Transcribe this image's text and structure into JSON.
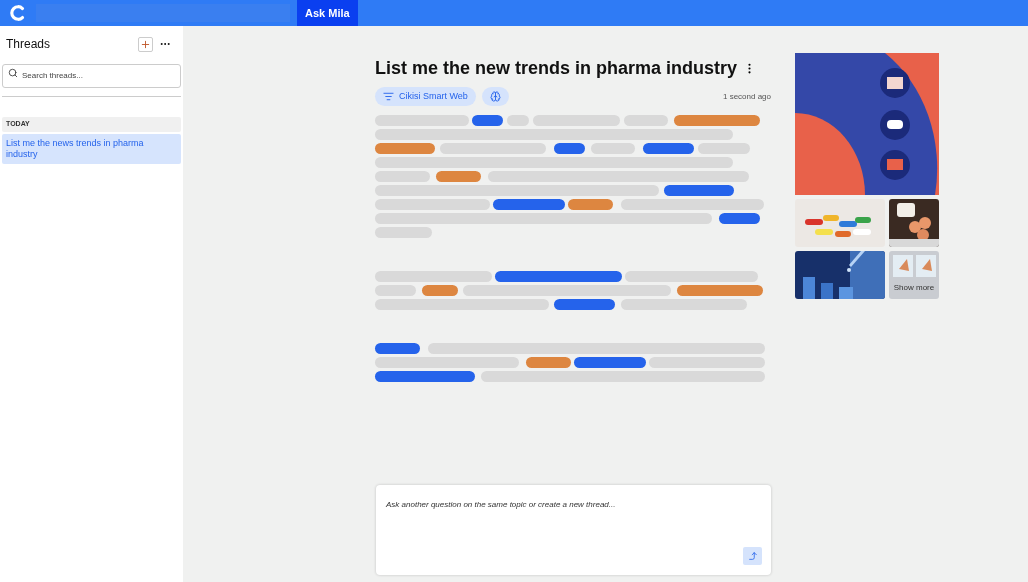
{
  "topbar": {
    "tabs": [
      {
        "label": "Ask Mila",
        "selected": true
      }
    ]
  },
  "sidebar": {
    "title": "Threads",
    "search": {
      "placeholder": "Search threads..."
    },
    "groups": [
      {
        "label": "TODAY",
        "items": [
          {
            "label": "List me the news trends in pharma industry",
            "selected": true
          }
        ]
      }
    ]
  },
  "thread": {
    "title": "List me the new trends in pharma industry",
    "source_chip": "Cikisi Smart Web",
    "timestamp": "1 second ago",
    "paragraphs": [
      {
        "lines": [
          {
            "segments": [
              {
                "color": "#d9d9d9"
              },
              {
                "color": "#2563eb"
              },
              {
                "color": "#d9d9d9"
              },
              {
                "color": "#d9d9d9"
              },
              {
                "color": "#d9d9d9"
              },
              {
                "color": "#dd8640"
              }
            ]
          },
          {
            "segments": [
              {
                "color": "#d9d9d9"
              }
            ]
          },
          {
            "segments": [
              {
                "color": "#dd8640"
              },
              {
                "color": "#d9d9d9"
              },
              {
                "color": "#2563eb"
              },
              {
                "color": "#d9d9d9"
              },
              {
                "color": "#2563eb"
              },
              {
                "color": "#d9d9d9"
              }
            ]
          },
          {
            "segments": [
              {
                "color": "#d9d9d9"
              }
            ]
          },
          {
            "segments": [
              {
                "color": "#d9d9d9"
              },
              {
                "color": "#dd8640"
              },
              {
                "color": "#d9d9d9"
              }
            ]
          },
          {
            "segments": [
              {
                "color": "#d9d9d9"
              },
              {
                "color": "#2563eb"
              }
            ]
          },
          {
            "segments": [
              {
                "color": "#d9d9d9"
              },
              {
                "color": "#2563eb"
              },
              {
                "color": "#dd8640"
              },
              {
                "color": "#d9d9d9"
              }
            ]
          },
          {
            "segments": [
              {
                "color": "#d9d9d9"
              },
              {
                "color": "#2563eb"
              }
            ]
          },
          {
            "segments": [
              {
                "color": "#d9d9d9"
              }
            ]
          }
        ]
      },
      {
        "lines": [
          {
            "segments": [
              {
                "color": "#d9d9d9"
              },
              {
                "color": "#2563eb"
              },
              {
                "color": "#d9d9d9"
              }
            ]
          },
          {
            "segments": [
              {
                "color": "#d9d9d9"
              },
              {
                "color": "#dd8640"
              },
              {
                "color": "#d9d9d9"
              },
              {
                "color": "#dd8640"
              }
            ]
          },
          {
            "segments": [
              {
                "color": "#d9d9d9"
              },
              {
                "color": "#2563eb"
              },
              {
                "color": "#d9d9d9"
              }
            ]
          }
        ]
      },
      {
        "lines": [
          {
            "segments": [
              {
                "color": "#2563eb"
              },
              {
                "color": "#d9d9d9"
              }
            ]
          },
          {
            "segments": [
              {
                "color": "#d9d9d9"
              },
              {
                "color": "#dd8640"
              },
              {
                "color": "#2563eb"
              },
              {
                "color": "#d9d9d9"
              }
            ]
          },
          {
            "segments": [
              {
                "color": "#2563eb"
              },
              {
                "color": "#d9d9d9"
              }
            ]
          }
        ]
      }
    ]
  },
  "media": {
    "show_more": "Show more"
  },
  "composer": {
    "placeholder": "Ask another question on the same topic or create a new thread..."
  }
}
